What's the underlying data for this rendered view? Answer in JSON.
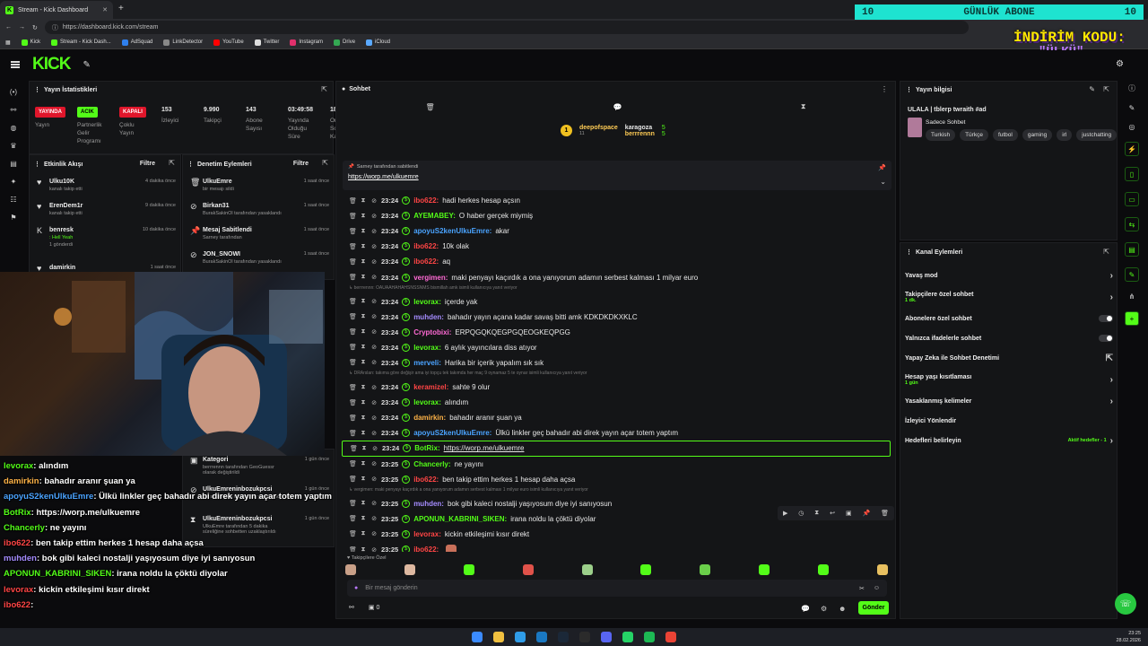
{
  "browser": {
    "tab_title": "Stream - Kick Dashboard",
    "url": "https://dashboard.kick.com/stream",
    "bookmarks": [
      {
        "label": "Kick",
        "color": "#53fc18"
      },
      {
        "label": "Stream - Kick Dash...",
        "color": "#53fc18"
      },
      {
        "label": "AdSquad",
        "color": "#2f80ed"
      },
      {
        "label": "LinkDetector",
        "color": "#888888"
      },
      {
        "label": "YouTube",
        "color": "#ff0000"
      },
      {
        "label": "Twitter",
        "color": "#dddddd"
      },
      {
        "label": "Instagram",
        "color": "#e1306c"
      },
      {
        "label": "Drive",
        "color": "#34a853"
      },
      {
        "label": "iCloud",
        "color": "#5aa9ff"
      }
    ]
  },
  "overlay_banner": {
    "left": "10",
    "text": "GÜNLÜK ABONE",
    "right": "10",
    "promo1": "İNDİRİM KODU:",
    "promo2": "\"ÜLKÜ\""
  },
  "header": {
    "logo": "KICK",
    "logo_sup": "BETA"
  },
  "stats": {
    "title": "Yayın İstatistikleri",
    "items": [
      {
        "badge": "YAYINDA",
        "label": "Yayın",
        "color": "#e0162b"
      },
      {
        "badge": "ACIK",
        "label": "Partnerlik Gelir Programı",
        "color": "#53fc18"
      },
      {
        "badge": "KAPALI",
        "label": "Çoklu Yayın",
        "color": "#e0162b"
      },
      {
        "value": "153",
        "label": "İzleyici"
      },
      {
        "value": "9.990",
        "label": "Takipçi"
      },
      {
        "value": "143",
        "label": "Abone Sayısı"
      },
      {
        "value": "03:49:58",
        "label": "Yayında Olduğu Süre"
      },
      {
        "value": "18",
        "label": "Ort. Sohbete Katılanlar"
      }
    ]
  },
  "activity": {
    "title": "Etkinlik Akışı",
    "filter": "Filtre",
    "items": [
      {
        "icon": "♥",
        "name": "Ulku10K",
        "sub": "kanalı takip etti",
        "time": "4 dakika önce"
      },
      {
        "icon": "♥",
        "name": "ErenDem1r",
        "sub": "kanalı takip etti",
        "time": "9 dakika önce"
      },
      {
        "icon": "K",
        "name": "benresk",
        "sub": ": Hell Yeah",
        "extra": "1 gönderdi",
        "time": "10 dakika önce"
      },
      {
        "icon": "♥",
        "name": "damirkin",
        "sub": "",
        "time": "1 saat önce"
      }
    ]
  },
  "moderation": {
    "title": "Denetim Eylemleri",
    "filter": "Filtre",
    "items": [
      {
        "icon": "🗑",
        "name": "UlkuEmre",
        "sub": "bir mesajı sildi",
        "time": "1 saat önce"
      },
      {
        "icon": "⊘",
        "name": "Birkan31",
        "sub": "BurakSakinOl tarafından yasaklandı",
        "time": "1 saat önce"
      },
      {
        "icon": "📌",
        "name": "Mesaj Sabitlendi",
        "sub": "Sarney tarafından",
        "time": "1 saat önce"
      },
      {
        "icon": "⊘",
        "name": "JON_SNOWI",
        "sub": "BurakSakinOl tarafından yasaklandı",
        "time": "1 saat önce"
      }
    ],
    "lower_items": [
      {
        "name": "Kategori",
        "sub": "berrrennn tarafından GeoGuessr olarak değiştirildi",
        "time": "1 gün önce"
      },
      {
        "name": "UlkuEmreninbozukpcsi",
        "sub": "BurakSakinOl tarafından yasaklandı",
        "time": "1 gün önce"
      },
      {
        "name": "UlkuEmreninbozukpcsi",
        "sub": "UlkuEmre tarafından 5 dakika süreliğine sohbetten uzaklaştırıldı",
        "time": "1 gün önce"
      }
    ]
  },
  "chat": {
    "title": "Sohbet",
    "gifters": [
      {
        "name": "deepofspace",
        "count": "11"
      },
      {
        "name": "karagoza",
        "count": "5"
      },
      {
        "name": "berrrennn",
        "count": "5"
      }
    ],
    "pinned": {
      "by": "Sarney tarafından sabitlendi",
      "link": "https://worp.me/ulkuemre"
    },
    "messages": [
      {
        "time": "23:24",
        "user": "ibo622",
        "color": "#ff4545",
        "text": "hadi herkes hesap açsın"
      },
      {
        "time": "23:24",
        "user": "AYEMABEY",
        "color": "#53fc18",
        "text": "O haber gerçek miymiş"
      },
      {
        "time": "23:24",
        "user": "apoyuS2kenUlkuEmre",
        "color": "#4aa3ff",
        "text": "akar"
      },
      {
        "time": "23:24",
        "user": "ibo622",
        "color": "#ff4545",
        "text": "10k olak"
      },
      {
        "time": "23:24",
        "user": "ibo622",
        "color": "#ff4545",
        "text": "aq"
      },
      {
        "time": "23:24",
        "user": "vergimen",
        "color": "#ff6ad5",
        "text": "maki penyayı kaçırdık a ona yanıyorum adamın serbest kalması 1 milyar euro"
      },
      {
        "reply": "berrrennn: OAUAAHAHAHSNSSNMS bismillah amk isimli kullanıcıya yanıt veriyor"
      },
      {
        "time": "23:24",
        "user": "levorax",
        "color": "#53fc18",
        "text": "içerde yak"
      },
      {
        "time": "23:24",
        "user": "muhden",
        "color": "#a58cff",
        "text": "bahadır yayın açana kadar savaş bitti amk KDKDKDKXKLC"
      },
      {
        "time": "23:24",
        "user": "Cryptobixi",
        "color": "#ff6ad5",
        "text": "ERPQGQKQEGPGQEOGKEQPGG"
      },
      {
        "time": "23:24",
        "user": "levorax",
        "color": "#53fc18",
        "text": "6 aylık yayıncılara diss atıyor"
      },
      {
        "time": "23:24",
        "user": "merveli",
        "color": "#4aa3ff",
        "text": "Harika bir içerik yapalım sık sık"
      },
      {
        "reply": "DRArslan: takıma göre değişir ama iyi topçu tek takımda her maç 9 oynamaz 5 te oynar isimli kullanıcıya yanıt veriyor"
      },
      {
        "time": "23:24",
        "user": "keramizel",
        "color": "#ff4545",
        "text": "sahte 9 olur"
      },
      {
        "time": "23:24",
        "user": "levorax",
        "color": "#53fc18",
        "text": "alındım"
      },
      {
        "time": "23:24",
        "user": "damirkin",
        "color": "#ffb347",
        "text": "bahadır aranır şuan ya"
      },
      {
        "time": "23:24",
        "user": "apoyuS2kenUlkuEmre",
        "color": "#4aa3ff",
        "text": "Ülkü linkler geç bahadır abi direk yayın açar totem yaptım"
      },
      {
        "time": "23:24",
        "user": "BotRix",
        "color": "#53fc18",
        "text": "https://worp.me/ulkuemre",
        "highlight": true
      },
      {
        "time": "23:25",
        "user": "Chancerly",
        "color": "#53fc18",
        "text": "ne yayını"
      },
      {
        "time": "23:25",
        "user": "ibo622",
        "color": "#ff4545",
        "text": "ben takip ettim herkes 1 hesap daha açsa"
      },
      {
        "reply": "vergimen: maki penyayı kaçırdık a ona yanıyorum adamın serbest kalması 1 milyar euro isimli kullanıcıya yanıt veriyor"
      },
      {
        "time": "23:25",
        "user": "muhden",
        "color": "#a58cff",
        "text": "bok gibi kaleci nostalji yaşıyosum diye iyi sanıyosun"
      },
      {
        "time": "23:25",
        "user": "APONUN_KABRINI_SIKEN",
        "color": "#53fc18",
        "text": "irana noldu la çöktü diyolar"
      },
      {
        "time": "23:25",
        "user": "levorax",
        "color": "#ff4545",
        "text": "kickin etkileşimi kısır direkt"
      },
      {
        "time": "23:25",
        "user": "ibo622",
        "color": "#ff4545",
        "text": ""
      }
    ],
    "followers_label": "Takipçilere Özel",
    "input_placeholder": "Bir mesaj gönderin",
    "send": "Gönder",
    "counter": "0"
  },
  "stream_info": {
    "title": "Yayın bilgisi",
    "stream_title": "ULALA | tblerp twraith #ad",
    "category": "Sadece Sohbet",
    "tags": [
      "Turkish",
      "Türkçe",
      "futbol",
      "gaming",
      "irl",
      "justchatting"
    ]
  },
  "channel_actions": {
    "title": "Kanal Eylemleri",
    "rows": [
      {
        "label": "Yavaş mod",
        "type": "chevron"
      },
      {
        "label": "Takipçilere özel sohbet",
        "sub": "1 dk.",
        "type": "chevron"
      },
      {
        "label": "Abonelere özel sohbet",
        "type": "toggle"
      },
      {
        "label": "Yalnızca ifadelerle sohbet",
        "type": "toggle"
      },
      {
        "label": "Yapay Zeka ile Sohbet Denetimi",
        "type": "link"
      },
      {
        "label": "Hesap yaşı kısıtlaması",
        "sub": "1 gün",
        "type": "chevron"
      },
      {
        "label": "Yasaklanmış kelimeler",
        "type": "chevron"
      },
      {
        "label": "İzleyici Yönlendir",
        "type": "none"
      },
      {
        "label": "Hedefleri belirleyin",
        "extra": "Aktif hedefler - 1",
        "type": "chevron"
      }
    ]
  },
  "webcam_overlay": [
    {
      "user": "levorax",
      "color": "#53fc18",
      "text": "alındım"
    },
    {
      "user": "damirkin",
      "color": "#ffb347",
      "text": "bahadır aranır şuan ya"
    },
    {
      "user": "apoyuS2kenUlkuEmre",
      "color": "#4aa3ff",
      "text": "Ülkü linkler geç bahadır abi direk yayın açar totem yaptım"
    },
    {
      "user": "BotRix",
      "color": "#53fc18",
      "text": "https://worp.me/ulkuemre"
    },
    {
      "user": "Chancerly",
      "color": "#53fc18",
      "text": "ne yayını"
    },
    {
      "user": "ibo622",
      "color": "#ff4545",
      "text": "ben takip ettim herkes 1 hesap daha açsa"
    },
    {
      "user": "muhden",
      "color": "#a58cff",
      "text": "bok gibi kaleci nostalji yaşıyosum diye iyi sanıyosun"
    },
    {
      "user": "APONUN_KABRINI_SIKEN",
      "color": "#53fc18",
      "text": "irana noldu la çöktü diyolar"
    },
    {
      "user": "levorax",
      "color": "#ff4545",
      "text": "kickin etkileşimi kısır direkt"
    },
    {
      "user": "ibo622",
      "color": "#ff4545",
      "text": ""
    }
  ],
  "taskbar": {
    "time": "23:25",
    "date": "28.02.2026"
  }
}
